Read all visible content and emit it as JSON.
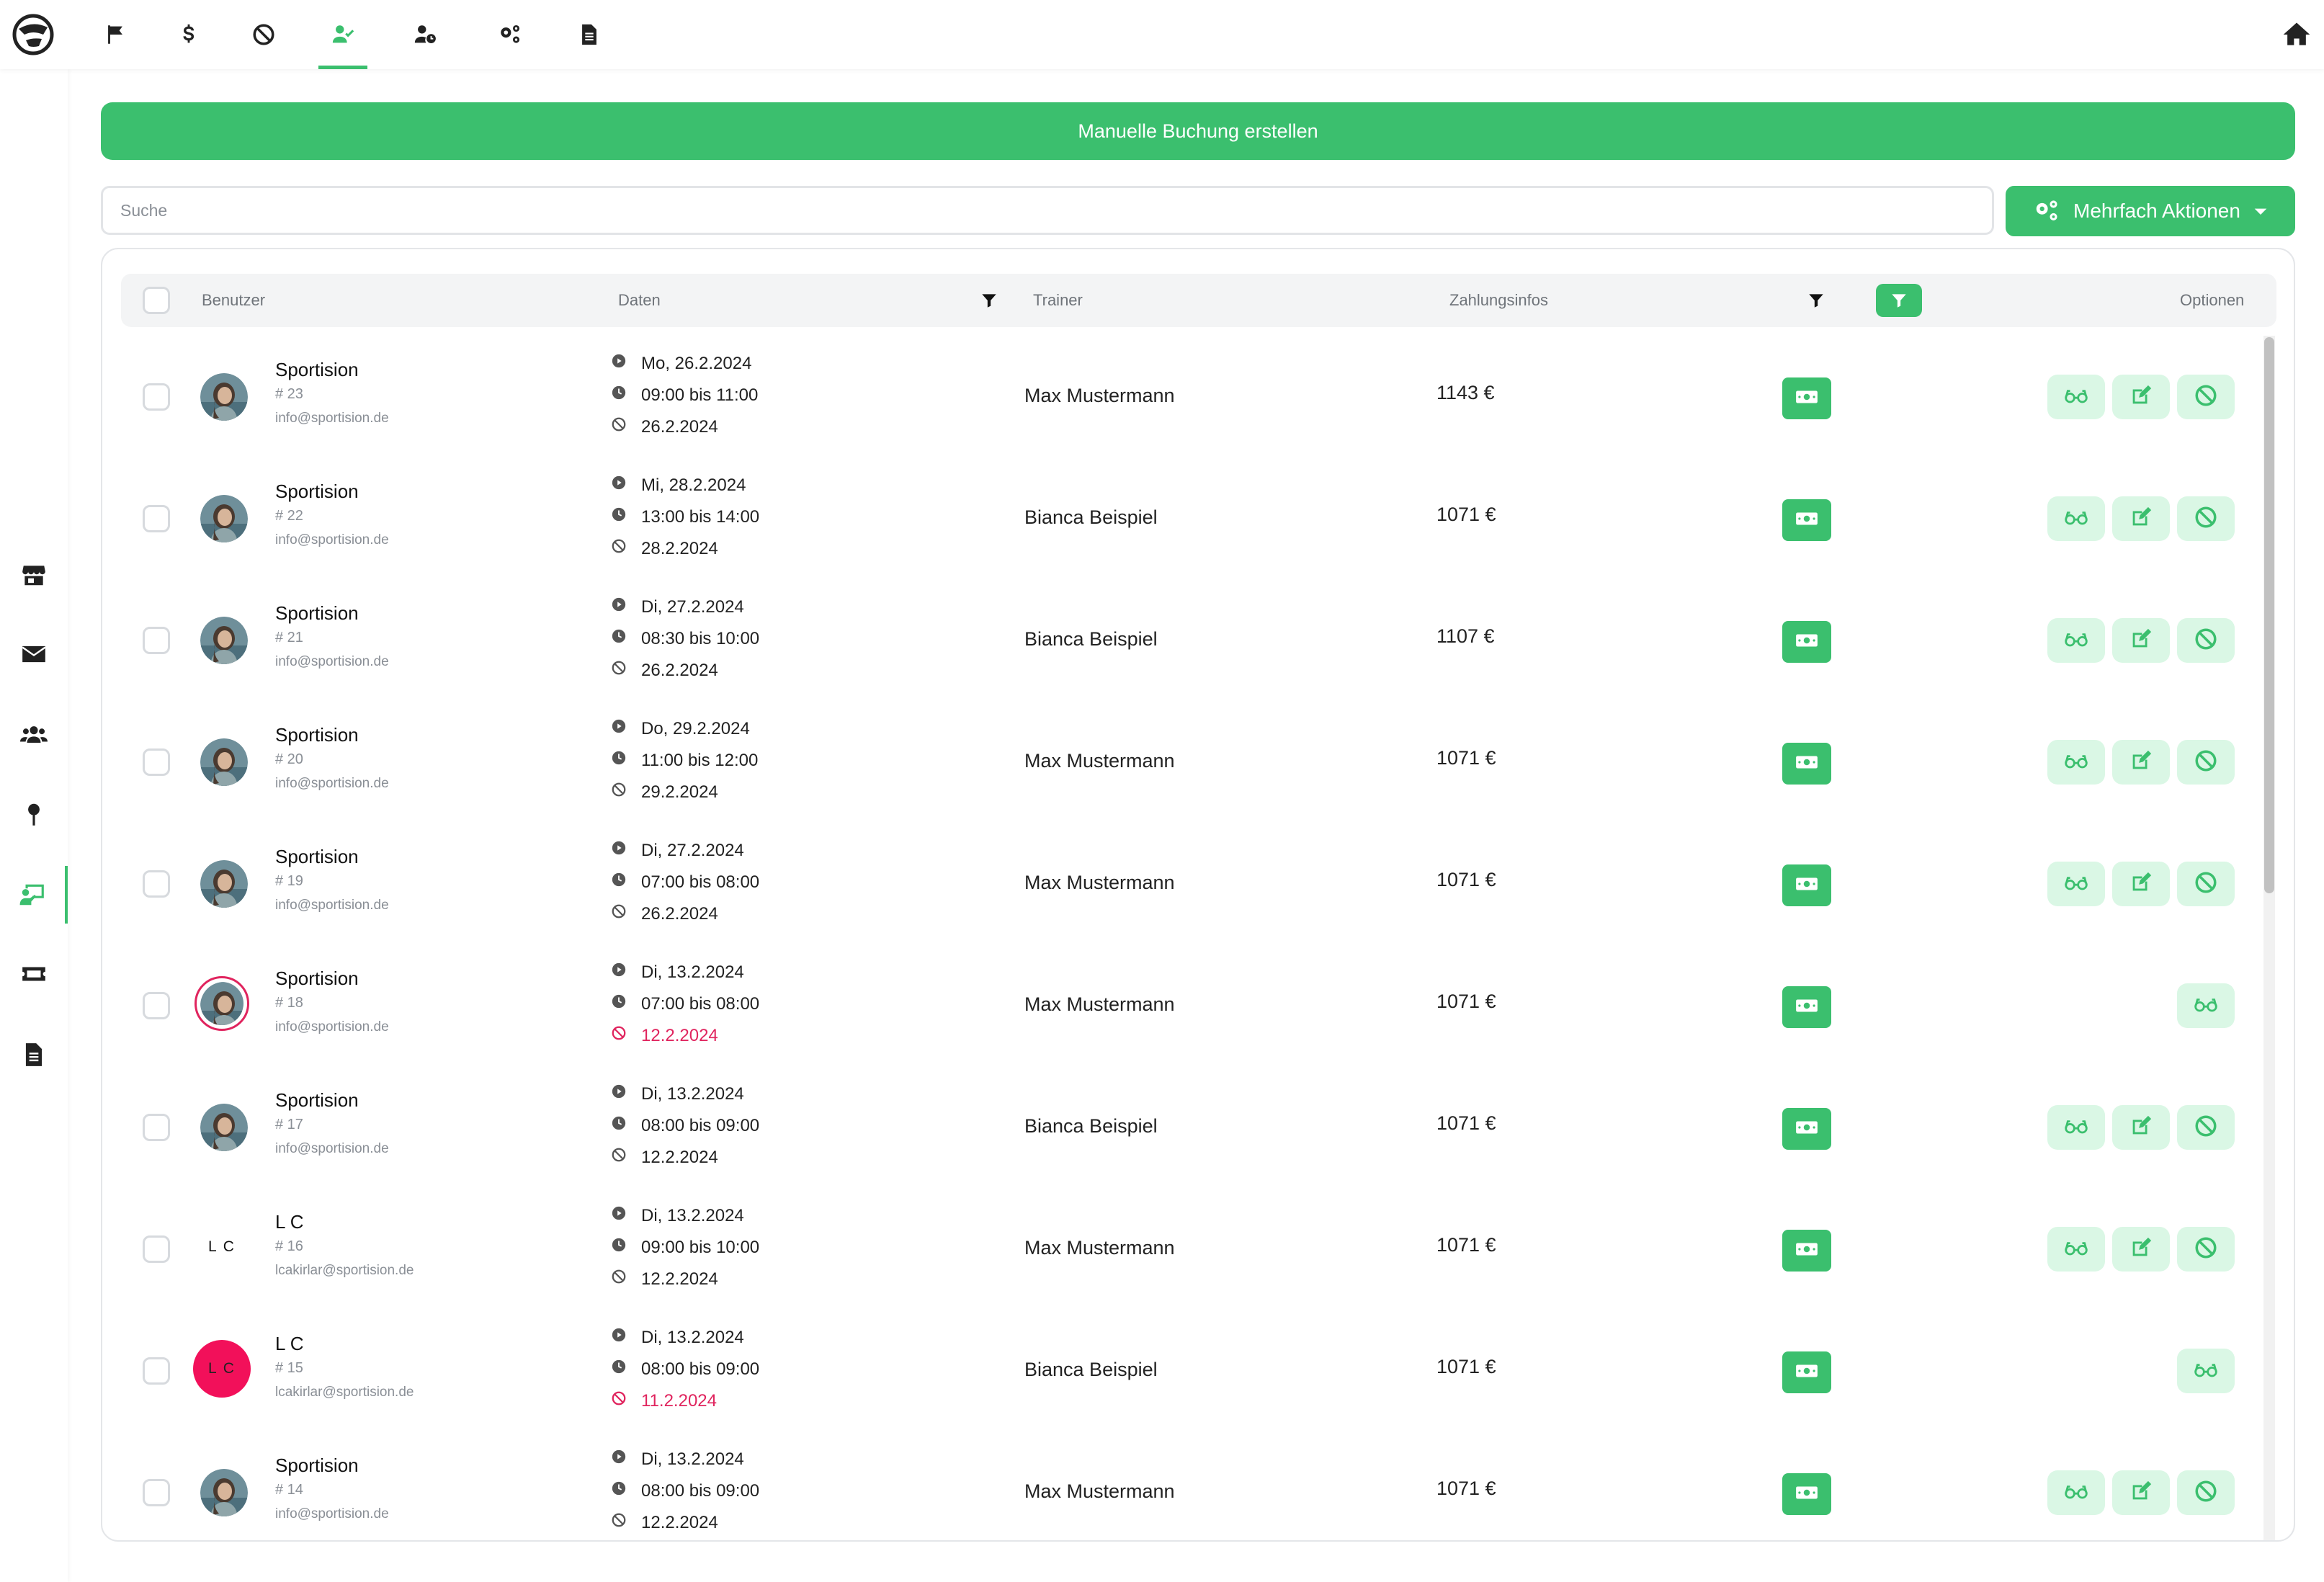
{
  "nav": {
    "top_icons": [
      "flag-icon",
      "dollar-icon",
      "ban-icon",
      "user-check-icon",
      "user-clock-icon",
      "cogs-icon",
      "file-icon"
    ],
    "active_top": "user-check-icon",
    "side_icons": [
      "store-icon",
      "envelope-icon",
      "users-icon",
      "map-pin-icon",
      "user-chalkboard-icon",
      "ticket-icon",
      "file-icon"
    ],
    "active_side": "user-chalkboard-icon"
  },
  "actions": {
    "create_label": "Manuelle Buchung erstellen",
    "search_placeholder": "Suche",
    "multi_label": "Mehrfach Aktionen"
  },
  "table": {
    "headers": {
      "user": "Benutzer",
      "dates": "Daten",
      "trainer": "Trainer",
      "payment": "Zahlungsinfos",
      "options": "Optionen"
    },
    "rows": [
      {
        "name": "Sportision",
        "id": "# 23",
        "email": "info@sportision.de",
        "avatar": "photo",
        "day": "Mo, 26.2.2024",
        "time": "09:00 bis 11:00",
        "cancel": "26.2.2024",
        "cancel_red": false,
        "trainer": "Max Mustermann",
        "amount": "1143 €",
        "full_options": true
      },
      {
        "name": "Sportision",
        "id": "# 22",
        "email": "info@sportision.de",
        "avatar": "photo",
        "day": "Mi, 28.2.2024",
        "time": "13:00 bis 14:00",
        "cancel": "28.2.2024",
        "cancel_red": false,
        "trainer": "Bianca Beispiel",
        "amount": "1071 €",
        "full_options": true
      },
      {
        "name": "Sportision",
        "id": "# 21",
        "email": "info@sportision.de",
        "avatar": "photo",
        "day": "Di, 27.2.2024",
        "time": "08:30 bis 10:00",
        "cancel": "26.2.2024",
        "cancel_red": false,
        "trainer": "Bianca Beispiel",
        "amount": "1107 €",
        "full_options": true
      },
      {
        "name": "Sportision",
        "id": "# 20",
        "email": "info@sportision.de",
        "avatar": "photo",
        "day": "Do, 29.2.2024",
        "time": "11:00 bis 12:00",
        "cancel": "29.2.2024",
        "cancel_red": false,
        "trainer": "Max Mustermann",
        "amount": "1071 €",
        "full_options": true
      },
      {
        "name": "Sportision",
        "id": "# 19",
        "email": "info@sportision.de",
        "avatar": "photo",
        "day": "Di, 27.2.2024",
        "time": "07:00 bis 08:00",
        "cancel": "26.2.2024",
        "cancel_red": false,
        "trainer": "Max Mustermann",
        "amount": "1071 €",
        "full_options": true
      },
      {
        "name": "Sportision",
        "id": "# 18",
        "email": "info@sportision.de",
        "avatar": "photo-ring",
        "day": "Di, 13.2.2024",
        "time": "07:00 bis 08:00",
        "cancel": "12.2.2024",
        "cancel_red": true,
        "trainer": "Max Mustermann",
        "amount": "1071 €",
        "full_options": false
      },
      {
        "name": "Sportision",
        "id": "# 17",
        "email": "info@sportision.de",
        "avatar": "photo",
        "day": "Di, 13.2.2024",
        "time": "08:00 bis 09:00",
        "cancel": "12.2.2024",
        "cancel_red": false,
        "trainer": "Bianca Beispiel",
        "amount": "1071 €",
        "full_options": true
      },
      {
        "name": "L C",
        "id": "# 16",
        "email": "lcakirlar@sportision.de",
        "avatar": "initials",
        "initials": "L C",
        "day": "Di, 13.2.2024",
        "time": "09:00 bis 10:00",
        "cancel": "12.2.2024",
        "cancel_red": false,
        "trainer": "Max Mustermann",
        "amount": "1071 €",
        "full_options": true
      },
      {
        "name": "L C",
        "id": "# 15",
        "email": "lcakirlar@sportision.de",
        "avatar": "initials-red",
        "initials": "L C",
        "day": "Di, 13.2.2024",
        "time": "08:00 bis 09:00",
        "cancel": "11.2.2024",
        "cancel_red": true,
        "trainer": "Bianca Beispiel",
        "amount": "1071 €",
        "full_options": false
      },
      {
        "name": "Sportision",
        "id": "# 14",
        "email": "info@sportision.de",
        "avatar": "photo",
        "day": "Di, 13.2.2024",
        "time": "08:00 bis 09:00",
        "cancel": "12.2.2024",
        "cancel_red": false,
        "trainer": "Max Mustermann",
        "amount": "1071 €",
        "full_options": true
      }
    ]
  },
  "colors": {
    "accent": "#3bbf6e",
    "accent_light": "#daf7e5",
    "danger": "#e0245e",
    "icon_dark": "#222222"
  }
}
